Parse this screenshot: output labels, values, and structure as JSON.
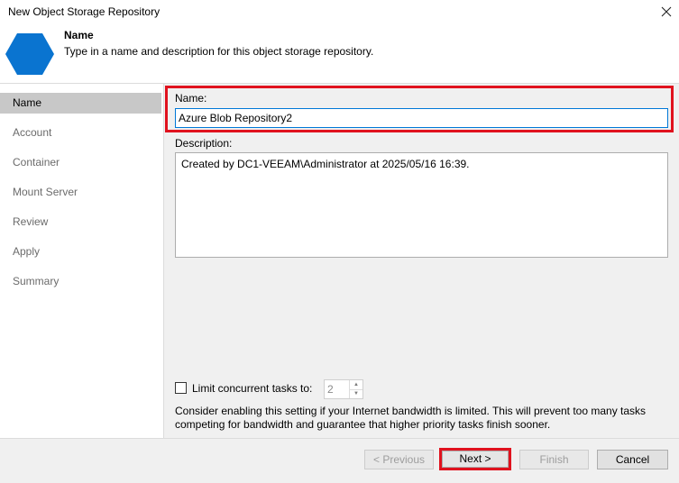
{
  "window": {
    "title": "New Object Storage Repository"
  },
  "header": {
    "title": "Name",
    "description": "Type in a name and description for this object storage repository."
  },
  "sidebar": {
    "items": [
      {
        "label": "Name"
      },
      {
        "label": "Account"
      },
      {
        "label": "Container"
      },
      {
        "label": "Mount Server"
      },
      {
        "label": "Review"
      },
      {
        "label": "Apply"
      },
      {
        "label": "Summary"
      }
    ],
    "active_index": 0
  },
  "form": {
    "name_label": "Name:",
    "name_value": "Azure Blob Repository2",
    "description_label": "Description:",
    "description_value": "Created by DC1-VEEAM\\Administrator at 2025/05/16 16:39.",
    "limit_checked": false,
    "limit_label": "Limit concurrent tasks to:",
    "limit_value": "2",
    "hint": "Consider enabling this setting if your Internet bandwidth is limited. This will prevent too many tasks competing for bandwidth and guarantee that higher priority tasks finish sooner."
  },
  "footer": {
    "previous_label": "< Previous",
    "next_label": "Next >",
    "finish_label": "Finish",
    "cancel_label": "Cancel"
  },
  "colors": {
    "accent": "#0078d7",
    "highlight": "#e0121e",
    "logo": "#0a74d0"
  },
  "icons": {
    "close": "close-icon",
    "logo": "hexagon-icon"
  }
}
